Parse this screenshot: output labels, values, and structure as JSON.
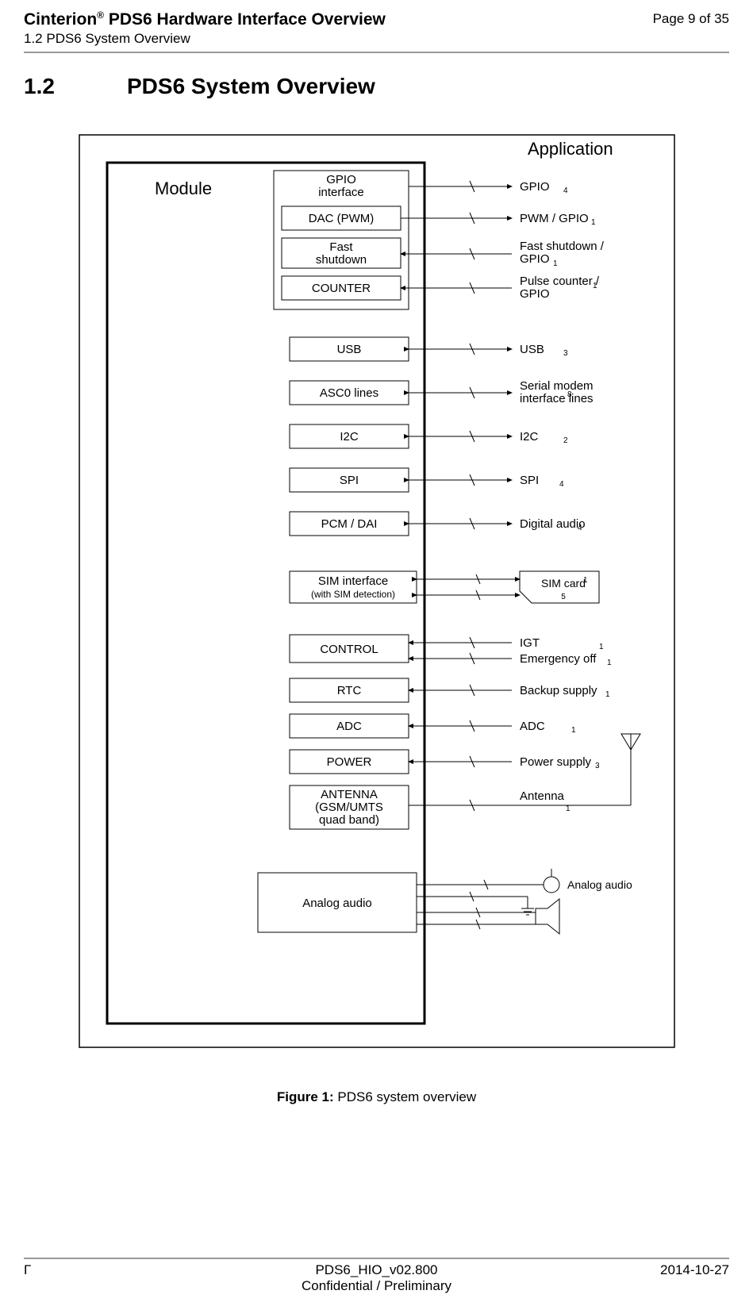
{
  "header": {
    "title_prefix": "Cinterion",
    "title_reg": "®",
    "title_suffix": " PDS6 Hardware Interface Overview",
    "subtitle": "1.2 PDS6 System Overview",
    "page_label": "Page 9 of 35"
  },
  "section": {
    "number": "1.2",
    "title": "PDS6 System Overview"
  },
  "diagram": {
    "application_label": "Application",
    "module_label": "Module",
    "gpio_group": {
      "title": "GPIO interface",
      "dac": "DAC (PWM)",
      "fast_shutdown": "Fast shutdown",
      "counter": "COUNTER"
    },
    "blocks": {
      "usb": "USB",
      "asc0": "ASC0 lines",
      "i2c": "I2C",
      "spi": "SPI",
      "pcm": "PCM / DAI",
      "sim": "SIM interface",
      "sim_sub": "(with SIM detection)",
      "control": "CONTROL",
      "rtc": "RTC",
      "adc": "ADC",
      "power": "POWER",
      "antenna_l1": "ANTENNA",
      "antenna_l2": "(GSM/UMTS",
      "antenna_l3": "quad band)",
      "analog_audio": "Analog  audio"
    },
    "right_labels": {
      "gpio": "GPIO",
      "pwm": "PWM / GPIO",
      "fast": "Fast shutdown / GPIO",
      "pulse": "Pulse counter / GPIO",
      "usb": "USB",
      "serial": "Serial modem interface lines",
      "i2c": "I2C",
      "spi": "SPI",
      "digital_audio": "Digital audio",
      "sim_card": "SIM card",
      "igt": "IGT",
      "emerg": "Emergency  off",
      "backup": "Backup  supply",
      "adc": "ADC",
      "power": "Power supply",
      "antenna": "Antenna",
      "analog_audio": "Analog audio"
    },
    "counts": {
      "gpio": "4",
      "pwm": "1",
      "fast": "1",
      "pulse": "1",
      "usb": "3",
      "serial": "8",
      "i2c": "2",
      "spi": "4",
      "digital_audio": "4",
      "sim_top": "1",
      "sim_main": "5",
      "igt": "1",
      "emerg": "1",
      "backup": "1",
      "adc": "1",
      "power": "3",
      "antenna": "1"
    }
  },
  "caption": {
    "label": "Figure 1:",
    "text": "  PDS6 system overview"
  },
  "footer": {
    "left_symbol": "Γ",
    "doc_id": "PDS6_HIO_v02.800",
    "confidential": "Confidential / Preliminary",
    "date": "2014-10-27"
  }
}
